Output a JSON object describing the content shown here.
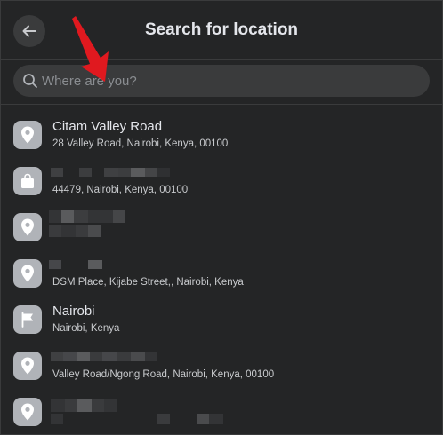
{
  "header": {
    "title": "Search for location",
    "back_icon": "arrow-left-icon"
  },
  "search": {
    "placeholder": "Where are you?",
    "value": "",
    "icon": "search-icon"
  },
  "locations": [
    {
      "icon": "map-pin-icon",
      "name": "Citam Valley Road",
      "address": "28 Valley Road, Nairobi, Kenya, 00100"
    },
    {
      "icon": "shopping-bag-icon",
      "name": "",
      "address": "44479, Nairobi, Kenya, 00100"
    },
    {
      "icon": "map-pin-icon",
      "name": "",
      "address": ""
    },
    {
      "icon": "map-pin-icon",
      "name": "",
      "address": "DSM Place, Kijabe Street,, Nairobi, Kenya"
    },
    {
      "icon": "flag-icon",
      "name": "Nairobi",
      "address": "Nairobi, Kenya"
    },
    {
      "icon": "map-pin-icon",
      "name": "",
      "address": "Valley Road/Ngong Road, Nairobi, Kenya, 00100"
    },
    {
      "icon": "map-pin-icon",
      "name": "",
      "address": ""
    }
  ],
  "colors": {
    "background": "#242526",
    "surface": "#3a3b3c",
    "text": "#e4e6eb",
    "annotation_arrow": "#e0191f"
  }
}
